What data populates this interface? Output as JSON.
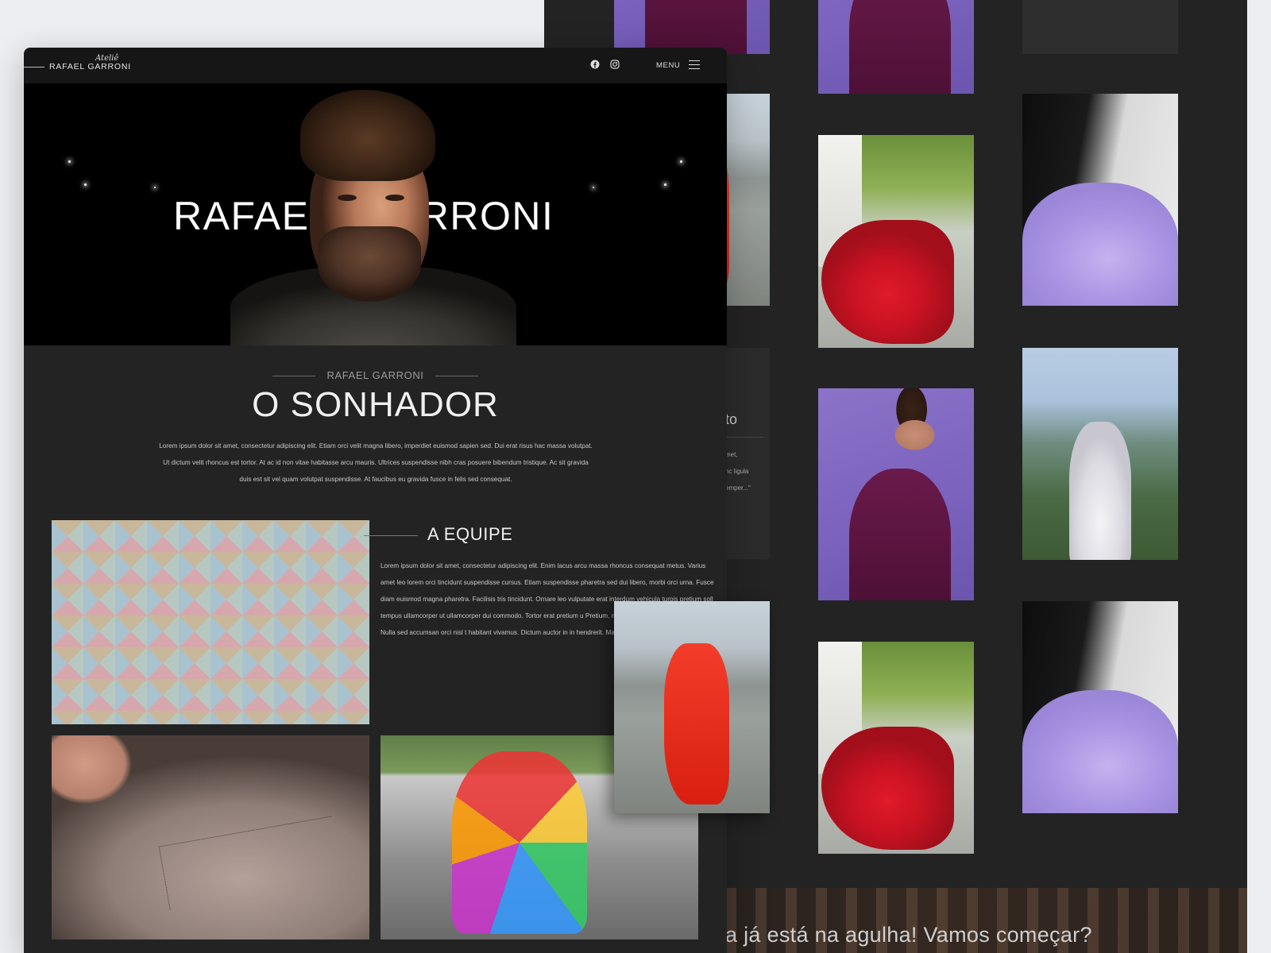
{
  "nav": {
    "logo_script": "Ateliê",
    "logo_name": "RAFAEL GARRONI",
    "menu_label": "MENU"
  },
  "hero": {
    "title_left": "RAFAEL",
    "title_right": "RRONI"
  },
  "intro": {
    "eyebrow": "RAFAEL GARRONI",
    "heading": "O SONHADOR",
    "paragraph": "Lorem ipsum dolor sit amet, consectetur adipiscing elit. Etiam orci velit magna libero, imperdiet euismod sapien sed. Dui erat risus hac massa volutpat. Ut dictum velit rhoncus est tortor. At ac id non vitae habitasse arcu mauris. Ultrices suspendisse nibh cras posuere bibendum tristique. Ac sit gravida duis est sit vel quam volutpat suspendisse. At faucibus eu gravida fusce in felis sed consequat."
  },
  "team": {
    "heading": "A EQUIPE",
    "paragraph": "Lorem ipsum dolor sit amet, consectetur adipiscing elit. Enim lacus arcu massa rhoncus consequat metus. Varius amet leo lorem orci tincidunt suspendisse cursus. Etiam suspendisse pharetra sed dui libero, morbi orci urna. Fusce diam euismod magna pharetra. Facilisis tris tincidunt. Ornare leo vulputate erat interdum vehicula turpis pretium soll tempus ullamcorper ut ullamcorper dui commodo. Tortor erat pretium u Pretium, mattis est eget senectus fringilla. Nulla sed accumsan orci nisl t habitant vivamus. Dictum auctor in in hendrerit. Massa suspendisse dui h"
  },
  "background_page": {
    "side_title": "to",
    "side_lines": [
      "met,",
      "nc ligula",
      "emper...\""
    ],
    "bottom_message": "a já está na agulha! Vamos começar?"
  }
}
